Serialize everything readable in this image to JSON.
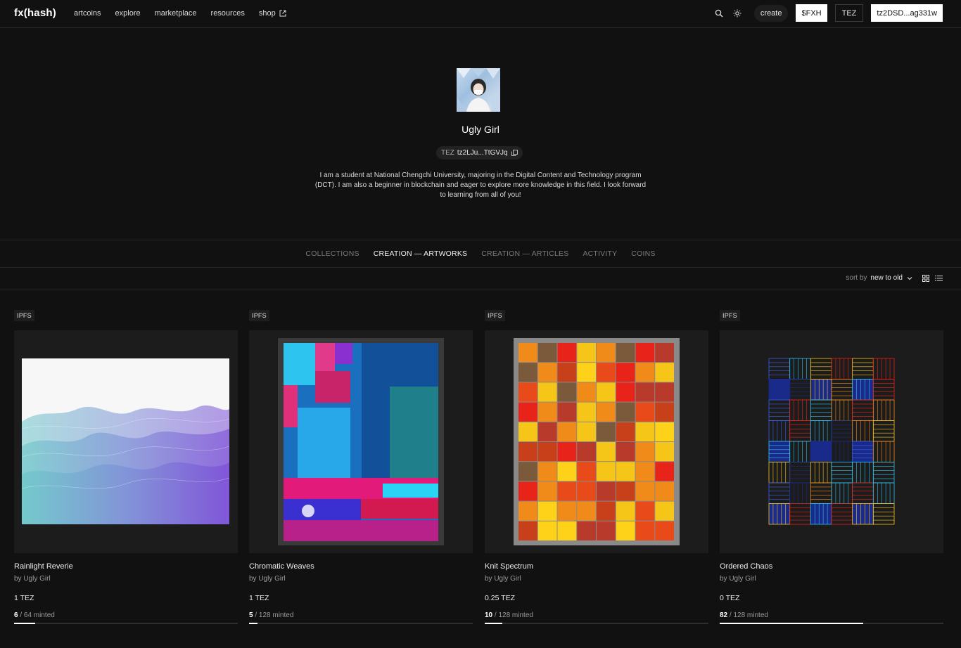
{
  "header": {
    "logo": "fx(hash)",
    "nav": [
      "artcoins",
      "explore",
      "marketplace",
      "resources",
      "shop"
    ],
    "create_label": "create",
    "fxh_label": "$FXH",
    "tez_label": "TEZ",
    "wallet_label": "tz2DSD...ag331w"
  },
  "profile": {
    "name": "Ugly Girl",
    "address_prefix": "TEZ",
    "address": "tz2LJu...TtGVJq",
    "bio": "I am a student at National Chengchi University, majoring in the Digital Content and Technology program (DCT). I am also a beginner in blockchain and eager to explore more knowledge in this field. I look forward to learning from all of you!"
  },
  "tabs": [
    {
      "label": "COLLECTIONS",
      "active": false
    },
    {
      "label": "CREATION — ARTWORKS",
      "active": true
    },
    {
      "label": "CREATION — ARTICLES",
      "active": false
    },
    {
      "label": "ACTIVITY",
      "active": false
    },
    {
      "label": "COINS",
      "active": false
    }
  ],
  "sort": {
    "label": "sort by",
    "value": "new to old"
  },
  "cards": [
    {
      "tag": "IPFS",
      "title": "Rainlight Reverie",
      "author": "by Ugly Girl",
      "price": "1 TEZ",
      "minted": "6",
      "total": " / 64 minted",
      "progress": 0.094
    },
    {
      "tag": "IPFS",
      "title": "Chromatic Weaves",
      "author": "by Ugly Girl",
      "price": "1 TEZ",
      "minted": "5",
      "total": " / 128 minted",
      "progress": 0.039
    },
    {
      "tag": "IPFS",
      "title": "Knit Spectrum",
      "author": "by Ugly Girl",
      "price": "0.25 TEZ",
      "minted": "10",
      "total": " / 128 minted",
      "progress": 0.078
    },
    {
      "tag": "IPFS",
      "title": "Ordered Chaos",
      "author": "by Ugly Girl",
      "price": "0 TEZ",
      "minted": "82",
      "total": " / 128 minted",
      "progress": 0.64
    }
  ],
  "colors": {
    "background": "#111111",
    "accent": "#ffffff"
  }
}
